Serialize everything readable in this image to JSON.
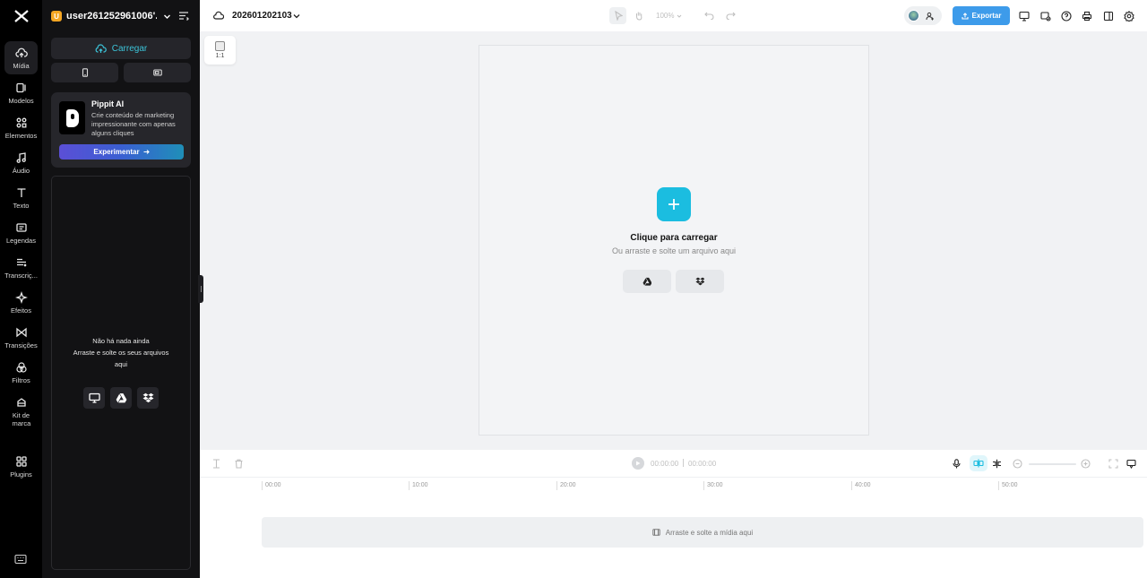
{
  "nav": {
    "items": [
      {
        "label": "Mídia",
        "icon": "cloud-upload-icon"
      },
      {
        "label": "Modelos",
        "icon": "template-icon"
      },
      {
        "label": "Elementos",
        "icon": "shapes-icon"
      },
      {
        "label": "Áudio",
        "icon": "music-note-icon"
      },
      {
        "label": "Texto",
        "icon": "text-t-icon"
      },
      {
        "label": "Legendas",
        "icon": "captions-icon"
      },
      {
        "label": "Transcriç...",
        "icon": "transcript-icon"
      },
      {
        "label": "Efeitos",
        "icon": "sparkle-icon"
      },
      {
        "label": "Transições",
        "icon": "transition-icon"
      },
      {
        "label": "Filtros",
        "icon": "filter-circles-icon"
      },
      {
        "label": "Kit de marca",
        "icon": "brand-kit-icon"
      },
      {
        "label": "Plugins",
        "icon": "grid-icon"
      }
    ]
  },
  "workspace": {
    "badge": "U",
    "name": "user261252961006'..."
  },
  "panel": {
    "upload_label": "Carregar",
    "promo": {
      "title": "Pippit AI",
      "description": "Crie conteúdo de marketing impressionante com apenas alguns cliques",
      "cta": "Experimentar"
    },
    "empty": {
      "line1": "Não há nada ainda",
      "line2": "Arraste e solte os seus arquivos aqui"
    }
  },
  "topbar": {
    "project_name": "202601202103",
    "zoom": "100%",
    "export_label": "Exportar"
  },
  "canvas": {
    "ratio_label": "1:1",
    "title": "Clique para carregar",
    "subtitle": "Ou arraste e solte um arquivo aqui"
  },
  "timeline": {
    "current_time": "00:00:00",
    "total_time": "00:00:00",
    "ticks": [
      "00:00",
      "10:00",
      "20:00",
      "30:00",
      "40:00",
      "50:00"
    ],
    "drop_label": "Arraste e solte a mídia aqui"
  },
  "colors": {
    "accent": "#1bbde0",
    "export": "#3d9bea",
    "rail_bg": "#000000",
    "panel_bg": "#121214"
  }
}
